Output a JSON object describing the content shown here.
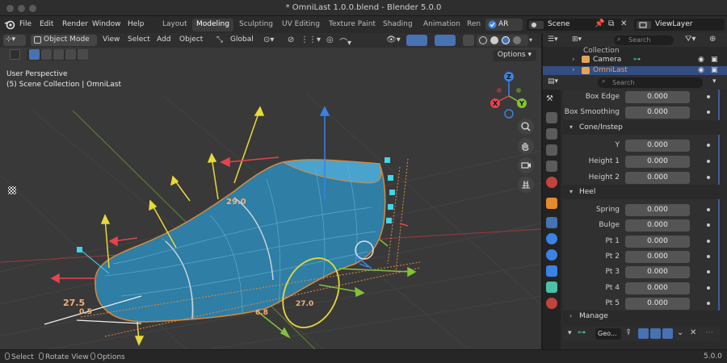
{
  "window": {
    "title": "* OmniLast 1.0.0.blend - Blender 5.0.0"
  },
  "menus": [
    "File",
    "Edit",
    "Render",
    "Window",
    "Help"
  ],
  "workspaces": {
    "tabs": [
      "Layout",
      "Modeling",
      "Sculpting",
      "UV Editing",
      "Texture Paint",
      "Shading",
      "Animation",
      "Ren"
    ],
    "active": "Modeling"
  },
  "header": {
    "ar_label": "AR",
    "scene": "Scene",
    "view_layer": "ViewLayer"
  },
  "viewport": {
    "mode": "Object Mode",
    "menus": [
      "View",
      "Select",
      "Add",
      "Object"
    ],
    "orientation": "Global",
    "options": "Options",
    "perspective": "User Perspective",
    "collection_info": "(5) Scene Collection | OmniLast",
    "axis_labels": {
      "z": "Z",
      "y": "Y",
      "x": "X"
    },
    "measurements": [
      "29.0",
      "27.5",
      "0.5",
      "6.8",
      "27.0"
    ]
  },
  "outliner": {
    "search_placeholder": "Search",
    "rows": [
      {
        "label": "Collection"
      },
      {
        "label": "Camera"
      },
      {
        "label": "OmniLast"
      }
    ]
  },
  "properties": {
    "search_placeholder": "Search",
    "rows_top": [
      {
        "label": "Box Edge",
        "value": "0.000"
      },
      {
        "label": "Box Smoothing",
        "value": "0.000"
      }
    ],
    "section_cone": "Cone/Instep",
    "rows_cone": [
      {
        "label": "Y",
        "value": "0.000"
      },
      {
        "label": "Height 1",
        "value": "0.000"
      },
      {
        "label": "Height 2",
        "value": "0.000"
      }
    ],
    "section_heel": "Heel",
    "rows_heel": [
      {
        "label": "Spring",
        "value": "0.000"
      },
      {
        "label": "Bulge",
        "value": "0.000"
      },
      {
        "label": "Pt 1",
        "value": "0.000"
      },
      {
        "label": "Pt 2",
        "value": "0.000"
      },
      {
        "label": "Pt 3",
        "value": "0.000"
      },
      {
        "label": "Pt 4",
        "value": "0.000"
      },
      {
        "label": "Pt 5",
        "value": "0.000"
      }
    ],
    "section_manage": "Manage",
    "footer_field": "Geo..."
  },
  "statusbar": {
    "select": "Select",
    "rotate": "Rotate View",
    "options": "Options",
    "version": "5.0.0"
  },
  "colors": {
    "accent": "#334d80",
    "shoe": "#2e7ea6",
    "axis_x": "#e8424e",
    "axis_y": "#82c237",
    "axis_z": "#3a82e3"
  }
}
